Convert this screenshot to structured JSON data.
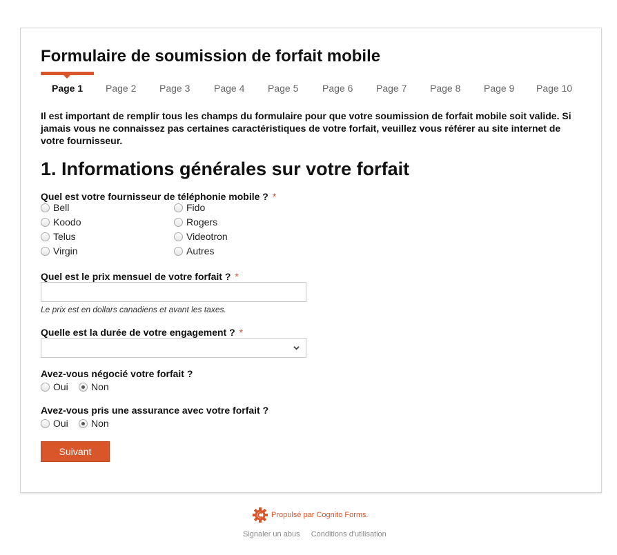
{
  "form": {
    "title": "Formulaire de soumission de forfait mobile",
    "pages": [
      "Page 1",
      "Page 2",
      "Page 3",
      "Page 4",
      "Page 5",
      "Page 6",
      "Page 7",
      "Page 8",
      "Page 9",
      "Page 10"
    ],
    "active_page": "Page 1",
    "intro": "Il est important de remplir tous les champs du formulaire pour que votre soumission de forfait mobile soit valide. Si jamais vous ne connaissez pas certaines caractéristiques de votre forfait, veuillez vous référer au site internet de votre fournisseur.",
    "section_title": "1. Informations générales sur votre forfait",
    "required_mark": "*",
    "q_provider": {
      "label": "Quel est votre fournisseur de téléphonie mobile ?",
      "options": [
        "Bell",
        "Fido",
        "Koodo",
        "Rogers",
        "Telus",
        "Videotron",
        "Virgin",
        "Autres"
      ]
    },
    "q_price": {
      "label": "Quel est le prix mensuel de votre forfait ?",
      "value": "",
      "help": "Le prix est en dollars canadiens et avant les taxes."
    },
    "q_duration": {
      "label": "Quelle est la durée de votre engagement ?",
      "selected": ""
    },
    "q_negotiated": {
      "label": "Avez-vous négocié votre forfait ?",
      "options": [
        "Oui",
        "Non"
      ],
      "selected": "Non"
    },
    "q_insurance": {
      "label": "Avez-vous pris une assurance avec votre forfait ?",
      "options": [
        "Oui",
        "Non"
      ],
      "selected": "Non"
    },
    "next_button": "Suivant"
  },
  "footer": {
    "powered_by": "Propulsé par Cognito Forms.",
    "report_abuse": "Signaler un abus",
    "terms": "Conditions d'utilisation"
  },
  "colors": {
    "accent": "#d9552a",
    "border": "#d4d4d4"
  },
  "icons": {
    "brand": "cognito-gear-icon",
    "select": "chevron-down-icon"
  }
}
